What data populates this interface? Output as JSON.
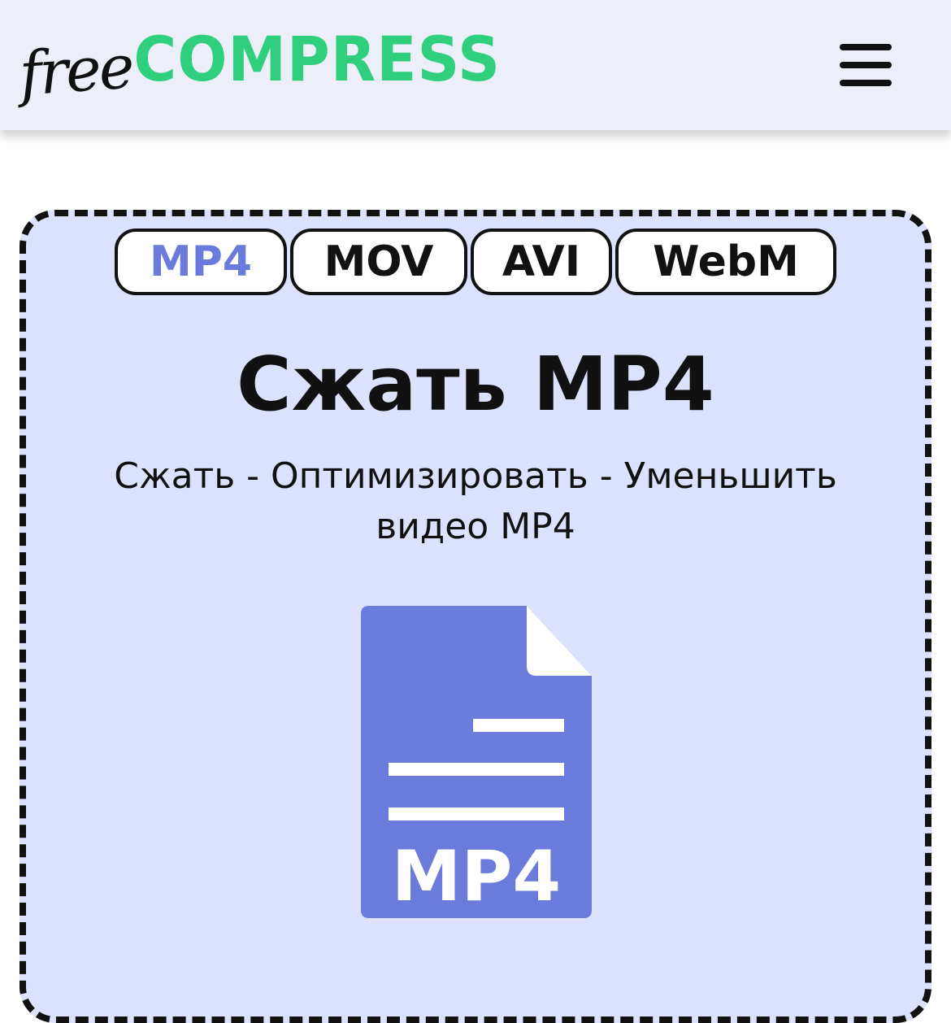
{
  "header": {
    "logo": {
      "free": "free",
      "compress": "COMPRESS"
    },
    "menu_icon": "hamburger-menu-icon"
  },
  "format_tabs": [
    {
      "label": "MP4",
      "active": true
    },
    {
      "label": "MOV",
      "active": false
    },
    {
      "label": "AVI",
      "active": false
    },
    {
      "label": "WebM",
      "active": false
    }
  ],
  "main": {
    "title": "Сжать MP4",
    "subtitle": "Сжать - Оптимизировать - Уменьшить видео MP4"
  },
  "upload": {
    "file_icon": "mp4-file-icon",
    "file_label": "MP4"
  },
  "colors": {
    "brand_green": "#2fcf7e",
    "accent_blue": "#6a7bdb",
    "dropzone_bg": "#dce2fd",
    "header_bg": "#eceff8"
  }
}
